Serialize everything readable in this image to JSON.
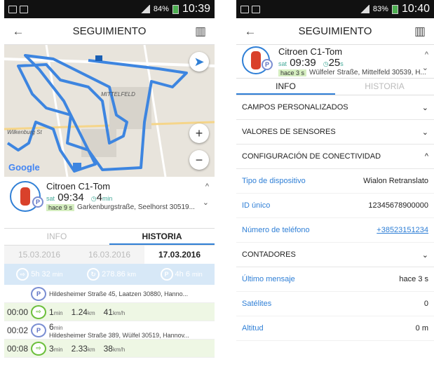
{
  "left": {
    "status": {
      "battery": "84%",
      "time": "10:39"
    },
    "appbar": {
      "title": "SEGUIMIENTO"
    },
    "map": {
      "provider": "Google",
      "labels": [
        "MITTELFELD",
        "Wilkenburg St"
      ]
    },
    "unit": {
      "name": "Citroen C1-Tom",
      "time": "09:34",
      "time_prefix": "sat",
      "duration": "4",
      "duration_unit": "min",
      "age": "hace 9 s",
      "address": "Garkenburgstraße, Seelhorst 30519..."
    },
    "tabs": [
      "INFO",
      "HISTORIA"
    ],
    "dates": [
      "15.03.2016",
      "16.03.2016",
      "17.03.2016"
    ],
    "summary": [
      {
        "icon": "trip-icon",
        "value": "5h 32",
        "unit": "min"
      },
      {
        "icon": "mileage-icon",
        "value": "278.86",
        "unit": "km"
      },
      {
        "icon": "parking-icon",
        "value": "4h 6",
        "unit": "min"
      }
    ],
    "history": [
      {
        "kind": "parking",
        "time": "",
        "address": "Hildesheimer Straße 45, Laatzen 30880, Hanno..."
      },
      {
        "kind": "trip",
        "time": "00:00",
        "duration": "1",
        "duration_unit": "min",
        "distance": "1.24",
        "distance_unit": "km",
        "speed": "41",
        "speed_unit": "km/h"
      },
      {
        "kind": "parking",
        "time": "00:02",
        "duration": "6",
        "duration_unit": "min",
        "address": "Hildesheimer Straße 389, Wülfel 30519, Hannov..."
      },
      {
        "kind": "trip",
        "time": "00:08",
        "duration": "3",
        "duration_unit": "min",
        "distance": "2.33",
        "distance_unit": "km",
        "speed": "38",
        "speed_unit": "km/h"
      }
    ]
  },
  "right": {
    "status": {
      "battery": "83%",
      "time": "10:40"
    },
    "appbar": {
      "title": "SEGUIMIENTO"
    },
    "unit": {
      "name": "Citroen C1-Tom",
      "time": "09:39",
      "time_prefix": "sat",
      "duration": "25",
      "duration_unit": "s",
      "age": "hace 3 s",
      "address": "Wülfeler Straße, Mittelfeld 30539, H..."
    },
    "tabs": [
      "INFO",
      "HISTORIA"
    ],
    "sections": {
      "custom": "CAMPOS PERSONALIZADOS",
      "sensors": "VALORES DE SENSORES",
      "connectivity": "CONFIGURACIÓN DE CONECTIVIDAD",
      "counters": "CONTADORES"
    },
    "connectivity_rows": [
      {
        "key": "Tipo de dispositivo",
        "value": "Wialon Retranslato"
      },
      {
        "key": "ID único",
        "value": "12345678900000"
      },
      {
        "key": "Número de teléfono",
        "value": "+38523151234"
      }
    ],
    "counter_rows": [
      {
        "key": "Último mensaje",
        "value": "hace 3 s"
      },
      {
        "key": "Satélites",
        "value": "0"
      },
      {
        "key": "Altitud",
        "value": "0 m"
      }
    ]
  }
}
